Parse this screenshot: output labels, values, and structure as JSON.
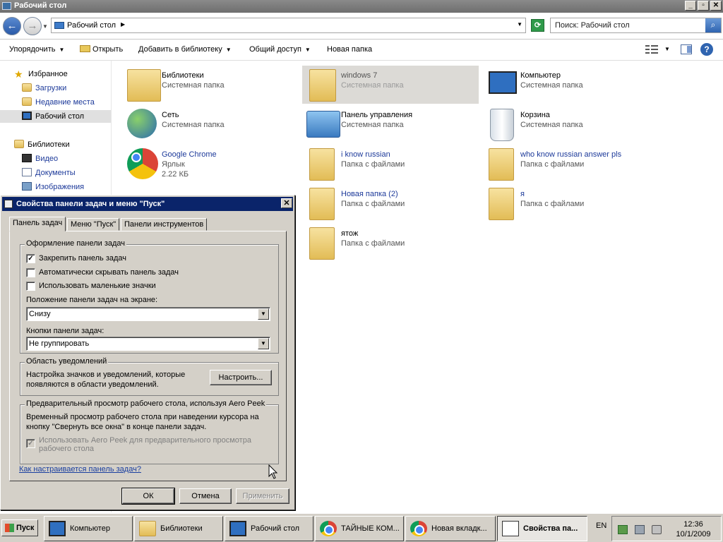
{
  "window": {
    "title": "Рабочий стол",
    "min": "_",
    "max": "▫",
    "close": "✕"
  },
  "address": {
    "path": "Рабочий стол",
    "search_placeholder": "Поиск: Рабочий стол"
  },
  "toolbar": {
    "organize": "Упорядочить",
    "open": "Открыть",
    "add_to_library": "Добавить в библиотеку",
    "share": "Общий доступ",
    "new_folder": "Новая папка"
  },
  "nav": {
    "favorites": "Избранное",
    "downloads": "Загрузки",
    "recent": "Недавние места",
    "desktop": "Рабочий стол",
    "libraries": "Библиотеки",
    "video": "Видео",
    "documents": "Документы",
    "images": "Изображения"
  },
  "items": [
    {
      "name": "Библиотеки",
      "type": "Системная папка"
    },
    {
      "name": "windows 7",
      "type": "Системная папка"
    },
    {
      "name": "Компьютер",
      "type": "Системная папка"
    },
    {
      "name": "Сеть",
      "type": "Системная папка"
    },
    {
      "name": "Панель управления",
      "type": "Системная папка"
    },
    {
      "name": "Корзина",
      "type": "Системная папка"
    },
    {
      "name": "Google Chrome",
      "type": "Ярлык",
      "size": "2.22 КБ"
    },
    {
      "name": "i know russian",
      "type": "Папка с файлами"
    },
    {
      "name": "who know russian answer pls",
      "type": "Папка с файлами"
    },
    {
      "name": "Новая папка (2)",
      "type": "Папка с файлами"
    },
    {
      "name": "я",
      "type": "Папка с файлами"
    },
    {
      "name": "ятож",
      "type": "Папка с файлами"
    }
  ],
  "dialog": {
    "title": "Свойства панели задач и меню \"Пуск\"",
    "tabs": [
      "Панель задач",
      "Меню \"Пуск\"",
      "Панели инструментов"
    ],
    "appearance_group": "Оформление панели задач",
    "lock": "Закрепить панель задач",
    "autohide": "Автоматически скрывать панель задач",
    "small_icons": "Использовать маленькие значки",
    "position_label": "Положение панели задач на экране:",
    "position_value": "Снизу",
    "buttons_label": "Кнопки панели задач:",
    "buttons_value": "Не группировать",
    "notify_group": "Область уведомлений",
    "notify_text1": "Настройка значков и уведомлений, которые",
    "notify_text2": "появляются в области уведомлений.",
    "customize": "Настроить...",
    "peek_group": "Предварительный просмотр рабочего стола, используя Aero Peek",
    "peek_text1": "Временный просмотр рабочего стола при наведении курсора на",
    "peek_text2": "кнопку \"Свернуть все окна\" в конце панели задач.",
    "peek_check1": "Использовать Aero Peek для предварительного просмотра",
    "peek_check2": "рабочего стола",
    "help_link": "Как настраивается панель задач?",
    "ok": "ОК",
    "cancel": "Отмена",
    "apply": "Применить",
    "checkmark": "✓"
  },
  "taskbar": {
    "start": "Пуск",
    "buttons": [
      "Компьютер",
      "Библиотеки",
      "Рабочий стол",
      "ТАЙНЫЕ КОМ...",
      "Новая вкладк...",
      "Свойства па..."
    ],
    "lang": "EN",
    "time": "12:36",
    "date": "10/1/2009"
  }
}
